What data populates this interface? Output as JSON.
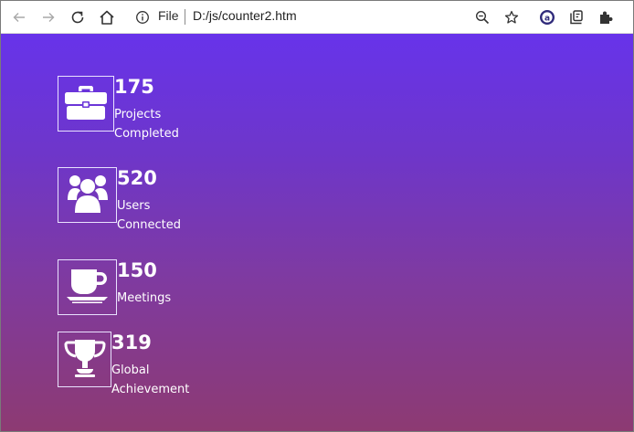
{
  "browser": {
    "file_label": "File",
    "url": "D:/js/counter2.htm",
    "icons": {
      "back": "arrow-left-icon",
      "forward": "arrow-right-icon",
      "reload": "reload-icon",
      "home": "home-icon",
      "site_info": "info-icon",
      "zoom": "zoom-out-icon",
      "favorite": "star-icon",
      "extension_a": "extension-a-icon",
      "collections": "collections-icon",
      "extensions": "puzzle-icon"
    }
  },
  "counters": [
    {
      "value": "175",
      "label": "Projects Completed",
      "icon": "briefcase-icon"
    },
    {
      "value": "520",
      "label": "Users Connected",
      "icon": "users-icon"
    },
    {
      "value": "150",
      "label": "Meetings",
      "icon": "coffee-cup-icon"
    },
    {
      "value": "319",
      "label": "Global Achievement",
      "icon": "trophy-icon"
    }
  ],
  "colors": {
    "gradient_top": "#6733ea",
    "gradient_bottom": "#8d3a72",
    "text": "#ffffff"
  }
}
